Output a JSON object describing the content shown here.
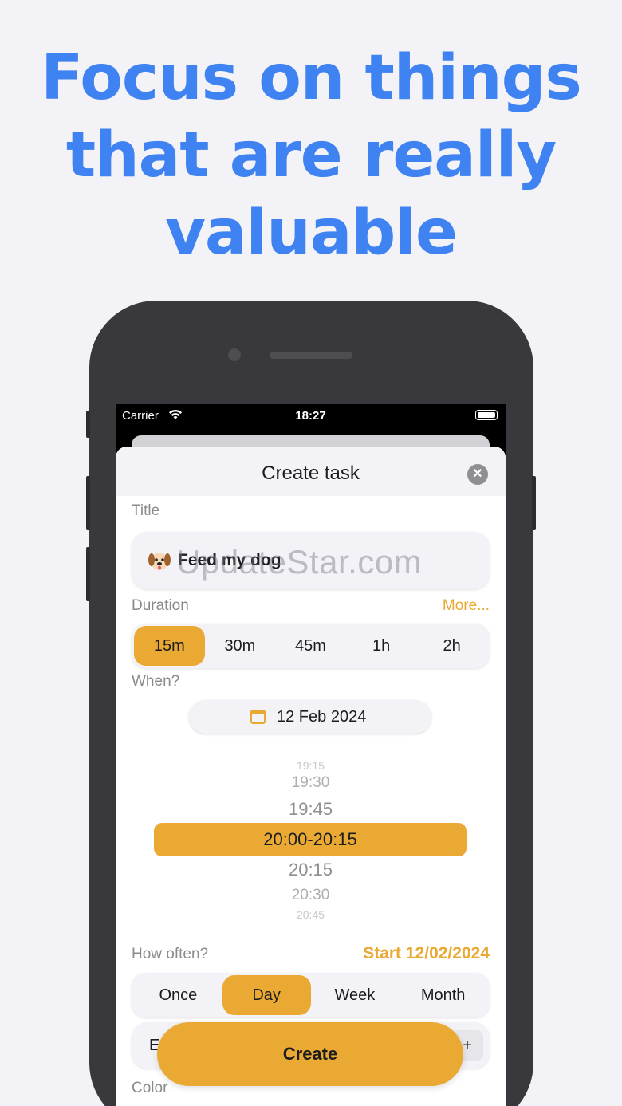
{
  "headline": {
    "line1": "Focus on things",
    "line2": "that are really",
    "line3": "valuable"
  },
  "status_bar": {
    "carrier": "Carrier",
    "time": "18:27",
    "wifi_icon": "wifi-icon",
    "battery_icon": "battery-icon"
  },
  "sheet": {
    "title": "Create task",
    "close_icon": "close-icon"
  },
  "title_section": {
    "label": "Title",
    "value": "Feed my dog",
    "emoji": "dog-face-emoji"
  },
  "watermark": "UpdateStar.com",
  "duration": {
    "label": "Duration",
    "more_label": "More...",
    "options": [
      "15m",
      "30m",
      "45m",
      "1h",
      "2h"
    ],
    "selected": "15m"
  },
  "when": {
    "label": "When?",
    "date": "12 Feb 2024",
    "calendar_icon": "calendar-icon",
    "time_wheel": {
      "above": [
        "19:15",
        "19:30",
        "19:45"
      ],
      "selected": "20:00-20:15",
      "below": [
        "20:15",
        "20:30",
        "20:45"
      ]
    }
  },
  "how_often": {
    "label": "How often?",
    "start_label": "Start 12/02/2024",
    "options": [
      "Once",
      "Day",
      "Week",
      "Month"
    ],
    "selected": "Day"
  },
  "ends_row": {
    "left_text": "E",
    "right_text": "+"
  },
  "color_label": "Color",
  "create_button": "Create",
  "colors": {
    "accent": "#eaa932",
    "headline": "#3f82f2",
    "phone": "#38383d",
    "background": "#f2f2f7"
  }
}
